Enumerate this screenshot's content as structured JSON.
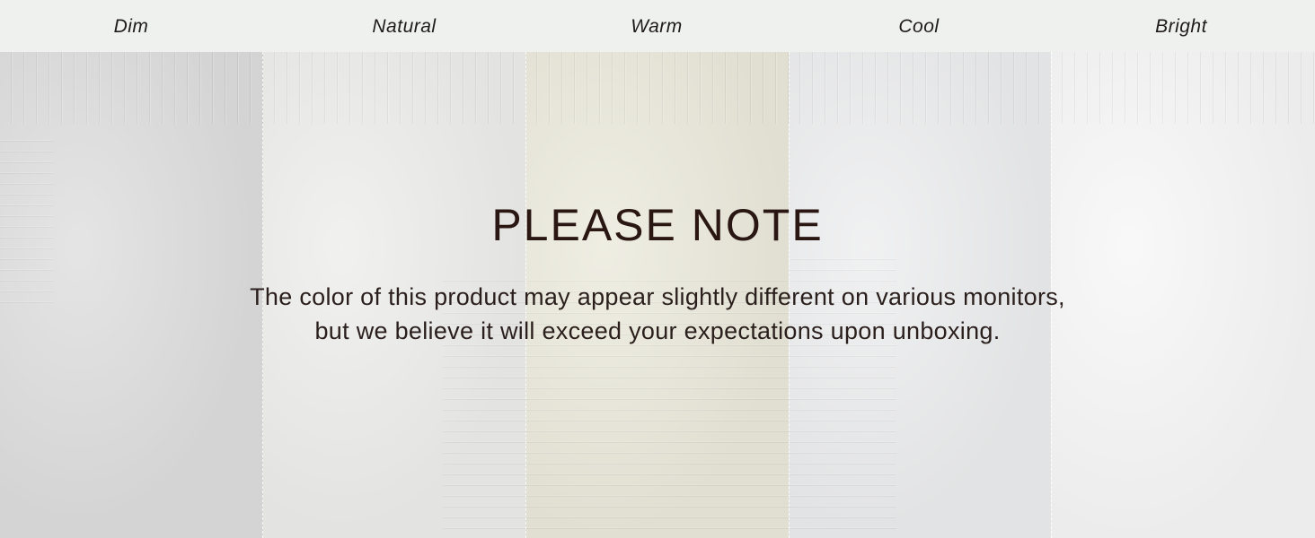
{
  "header": {
    "labels": [
      "Dim",
      "Natural",
      "Warm",
      "Cool",
      "Bright"
    ]
  },
  "panels": {
    "colors": [
      "#dcdcdc",
      "#ececea",
      "#eae8da",
      "#ebeced",
      "#f6f6f6"
    ]
  },
  "notice": {
    "title": "PLEASE NOTE",
    "line1": "The color of this product may appear slightly different on various monitors,",
    "line2": "but we believe it will exceed your expectations upon unboxing."
  }
}
